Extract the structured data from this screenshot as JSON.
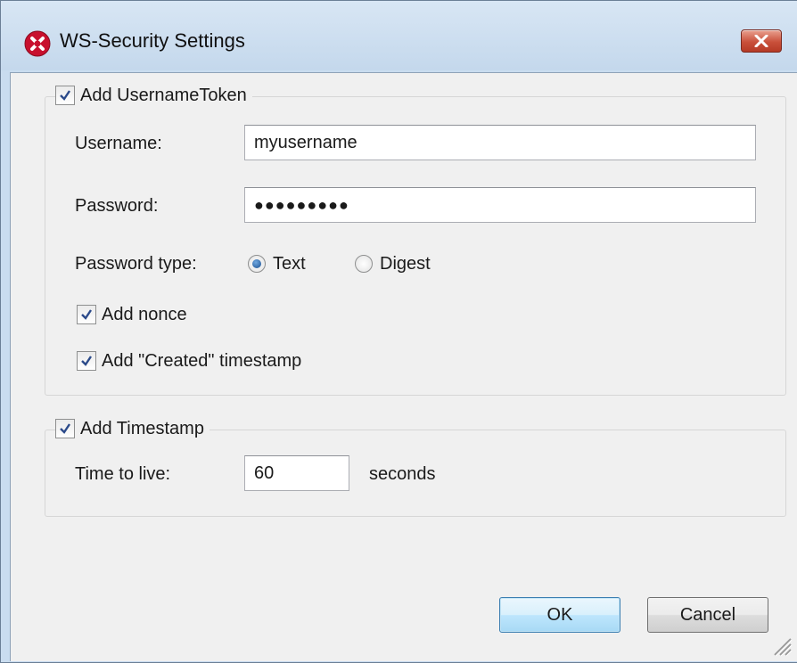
{
  "window": {
    "title": "WS-Security Settings",
    "app_icon": "altova-logo-icon",
    "close_icon": "close-icon"
  },
  "username_token": {
    "label": "Add UsernameToken",
    "checked": true,
    "username_label": "Username:",
    "username_value": "myusername",
    "password_label": "Password:",
    "password_mask": "●●●●●●●●●",
    "password_type_label": "Password type:",
    "password_type_options": [
      {
        "label": "Text",
        "selected": true
      },
      {
        "label": "Digest",
        "selected": false
      }
    ],
    "add_nonce_label": "Add nonce",
    "add_nonce_checked": true,
    "add_created_label": "Add \"Created\" timestamp",
    "add_created_checked": true
  },
  "timestamp": {
    "label": "Add Timestamp",
    "checked": true,
    "ttl_label": "Time to live:",
    "ttl_value": "60",
    "ttl_unit": "seconds"
  },
  "buttons": {
    "ok": "OK",
    "cancel": "Cancel"
  },
  "colors": {
    "title_bar": "#c4d8ec",
    "client_bg": "#f0f0f0",
    "close_button": "#c9503a",
    "default_button": "#bee6fd",
    "radio_dot": "#1a4f8f"
  }
}
